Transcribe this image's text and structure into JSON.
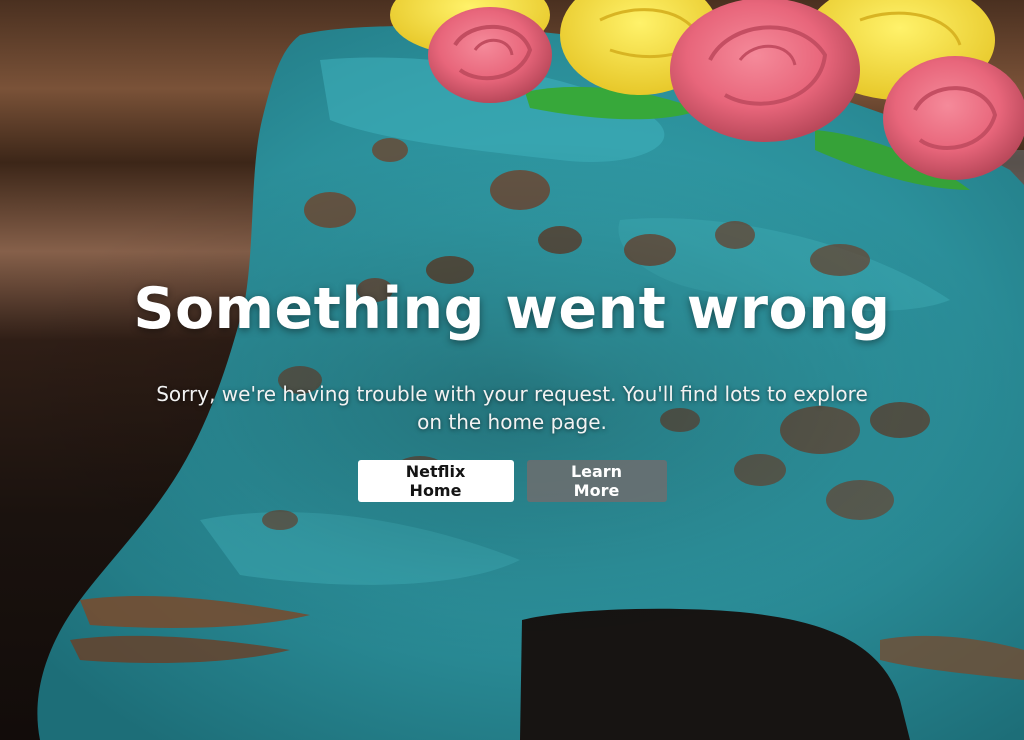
{
  "error": {
    "title": "Something went wrong",
    "message": "Sorry, we're having trouble with your request. You'll find lots to explore on the home page."
  },
  "actions": {
    "primary_label": "Netflix Home",
    "secondary_label": "Learn More"
  },
  "colors": {
    "primary_button_bg": "#ffffff",
    "primary_button_text": "#141414",
    "secondary_button_bg": "#6d6d6e",
    "frosting": "#2d98a3"
  }
}
